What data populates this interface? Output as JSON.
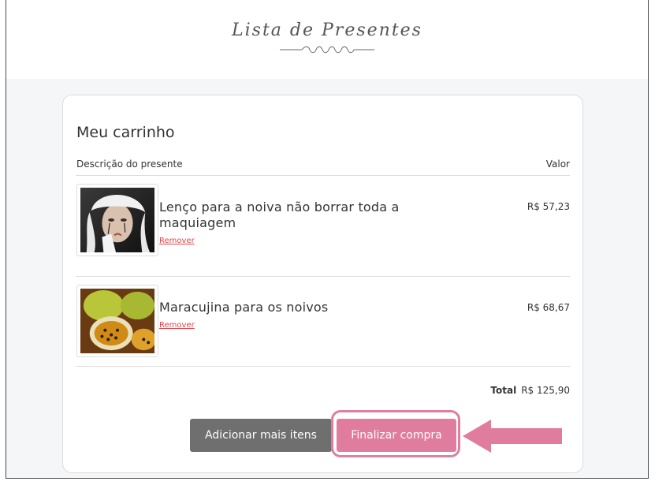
{
  "header": {
    "logo_text": "Lista de Presentes"
  },
  "cart": {
    "title": "Meu carrinho",
    "col_description": "Descrição do presente",
    "col_value": "Valor",
    "items": [
      {
        "name": "Lenço para a noiva não borrar toda a maquiagem",
        "remove_label": "Remover",
        "price": "R$ 57,23",
        "image": "crying-bride-photo"
      },
      {
        "name": "Maracujina para os noivos",
        "remove_label": "Remover",
        "price": "R$ 68,67",
        "image": "passion-fruit-photo"
      }
    ],
    "total_label": "Total",
    "total_value": "R$ 125,90"
  },
  "actions": {
    "add_more_label": "Adicionar mais itens",
    "finish_label": "Finalizar compra"
  },
  "colors": {
    "accent_pink": "#e07c9d",
    "secondary_gray": "#6f6f6f",
    "remove_red": "#e0454a"
  }
}
